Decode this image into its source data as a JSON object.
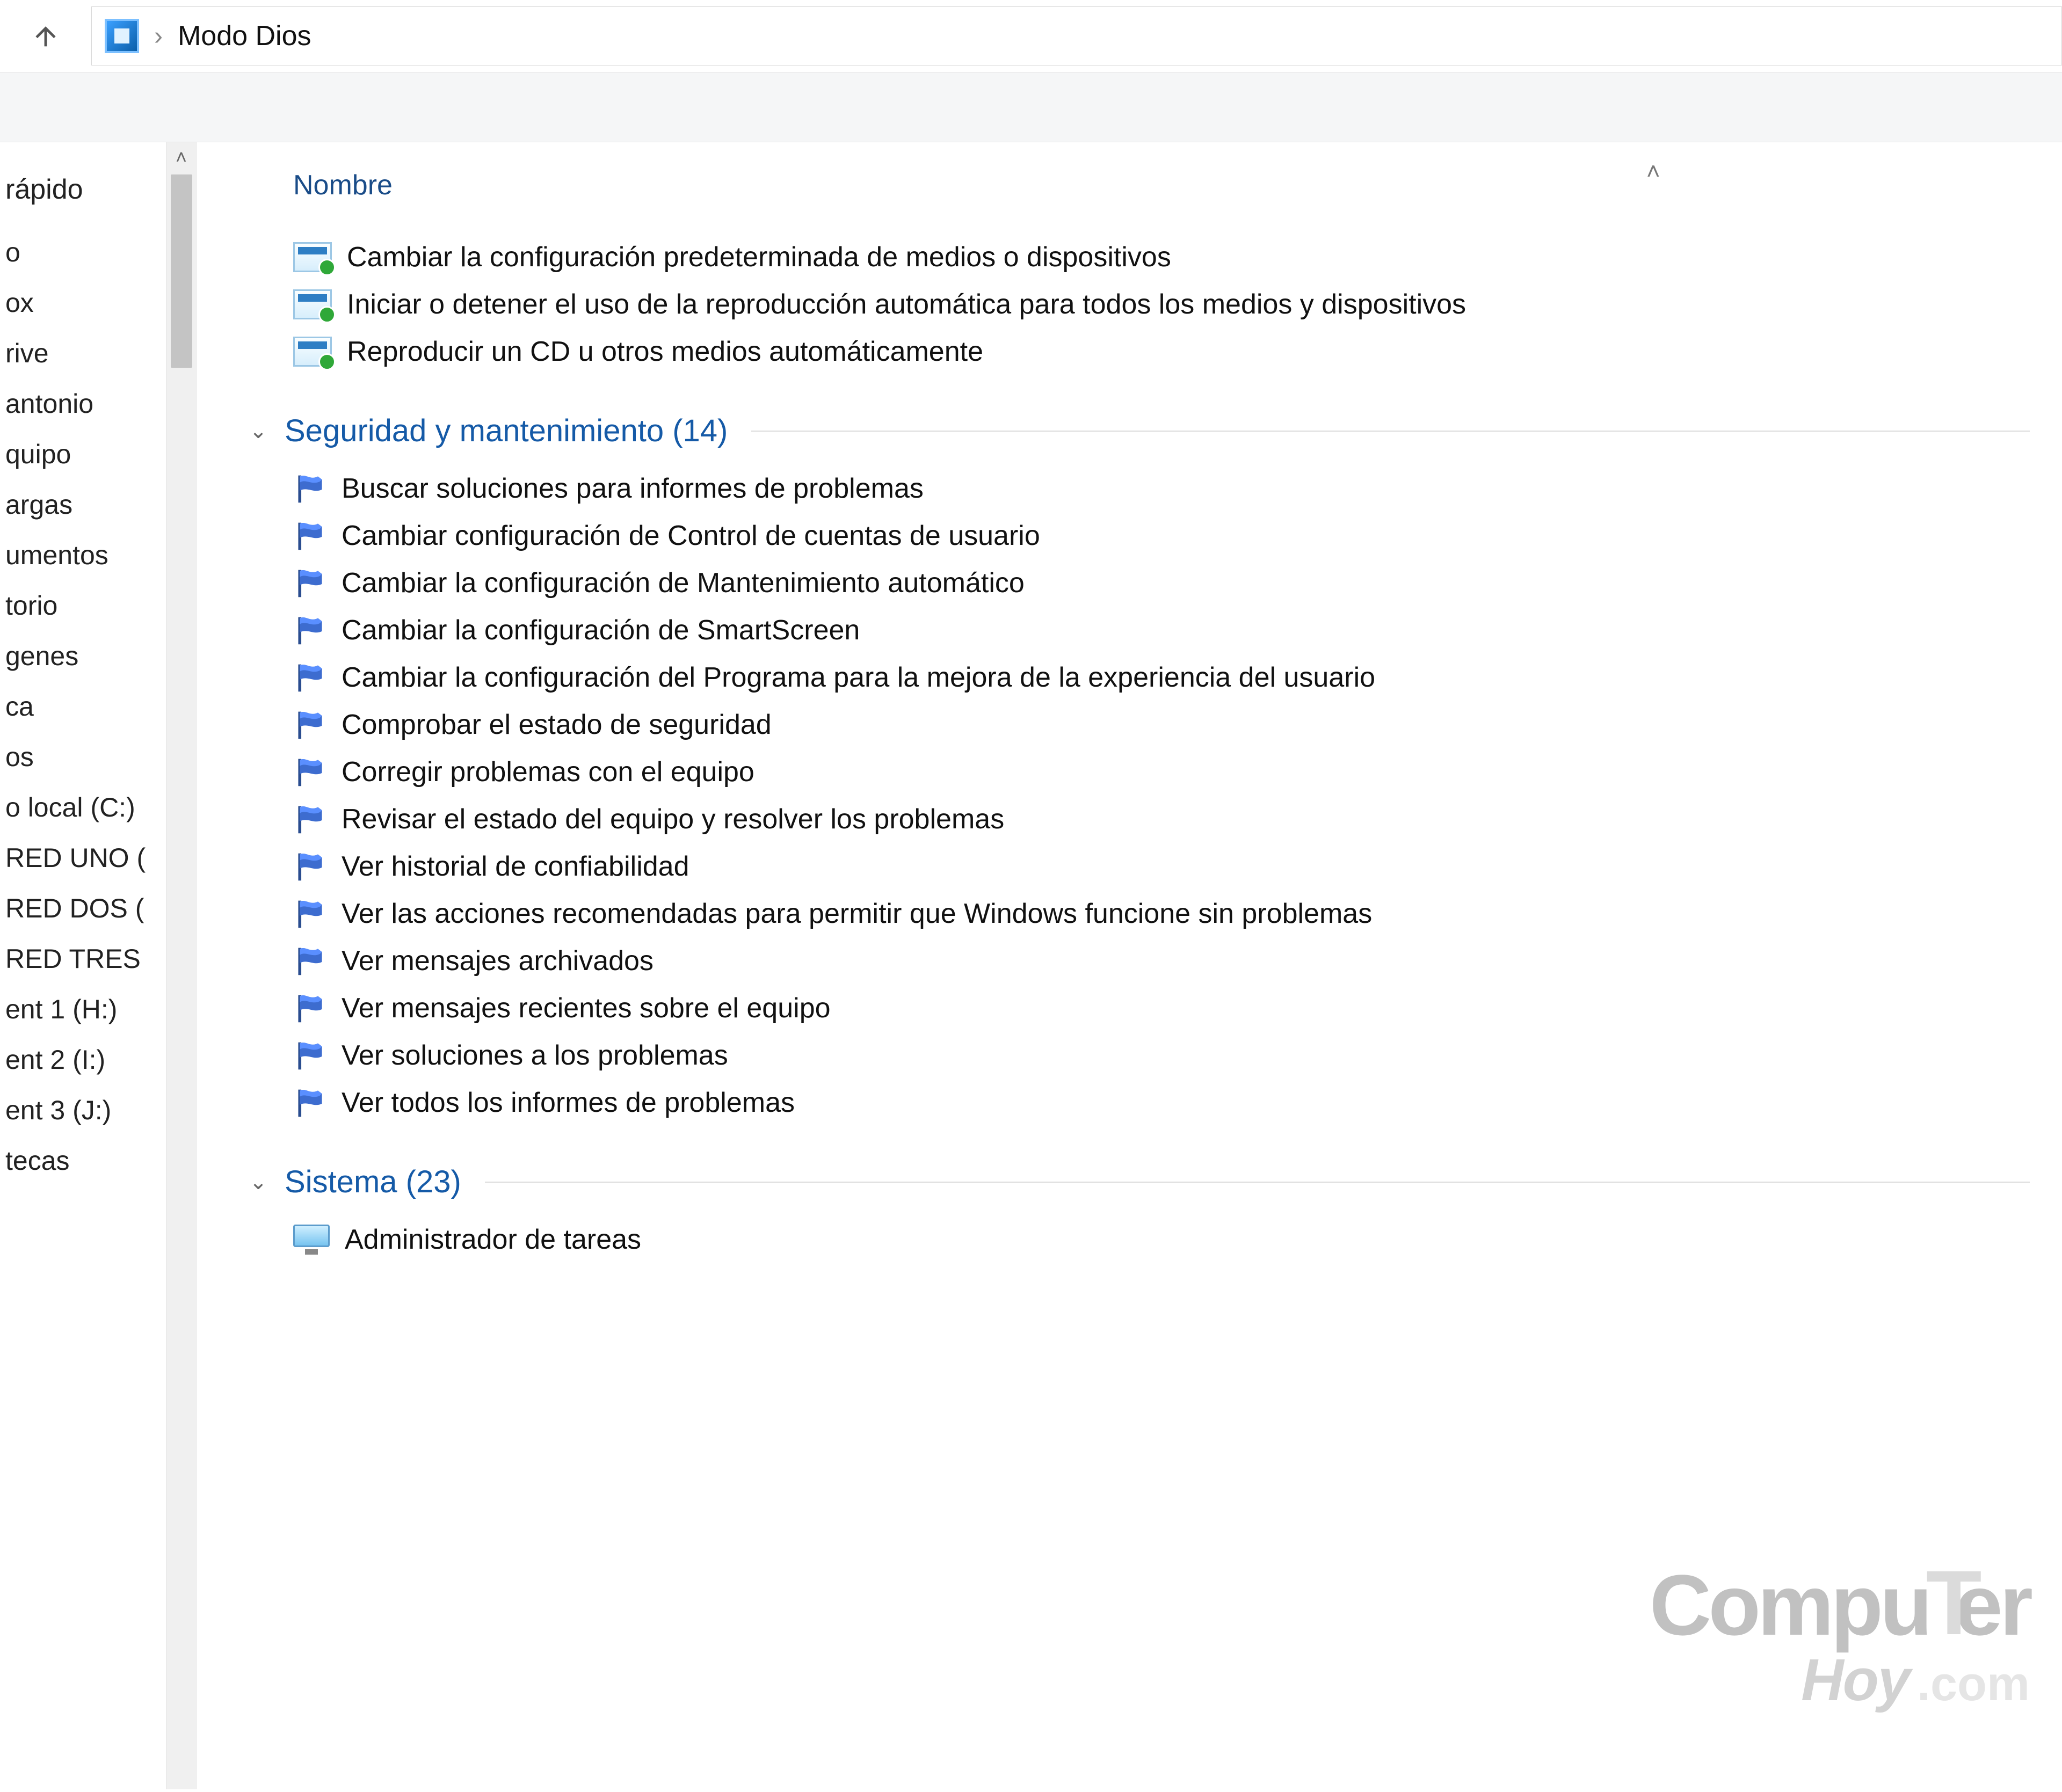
{
  "breadcrumb": {
    "location": "Modo Dios"
  },
  "column_header": "Nombre",
  "sidebar": {
    "header": "rápido",
    "items": [
      "o",
      "ox",
      "rive",
      "antonio",
      "quipo",
      "argas",
      "umentos",
      "torio",
      "genes",
      "ca",
      "os",
      "o local (C:)",
      "RED UNO (",
      "RED DOS (",
      "RED TRES",
      "ent 1 (H:)",
      "ent 2 (I:)",
      "ent 3 (J:)",
      "tecas"
    ]
  },
  "ungrouped": [
    "Cambiar la configuración predeterminada de medios o dispositivos",
    "Iniciar o detener el uso de la reproducción automática para todos los medios y dispositivos",
    "Reproducir un CD u otros medios automáticamente"
  ],
  "groups": [
    {
      "title": "Seguridad y mantenimiento (14)",
      "icon": "flag",
      "items": [
        "Buscar soluciones para informes de problemas",
        "Cambiar configuración de Control de cuentas de usuario",
        "Cambiar la configuración de Mantenimiento automático",
        "Cambiar la configuración de SmartScreen",
        "Cambiar la configuración del Programa para la mejora de la experiencia del usuario",
        "Comprobar el estado de seguridad",
        "Corregir problemas con el equipo",
        "Revisar el estado del equipo y resolver los problemas",
        "Ver historial de confiabilidad",
        "Ver las acciones recomendadas para permitir que Windows funcione sin problemas",
        "Ver mensajes archivados",
        "Ver mensajes recientes sobre el equipo",
        "Ver soluciones a los problemas",
        "Ver todos los informes de problemas"
      ]
    },
    {
      "title": "Sistema (23)",
      "icon": "monitor",
      "items": [
        "Administrador de tareas"
      ]
    }
  ],
  "watermark": {
    "line1a": "Compu",
    "line1b": "er",
    "line2": "Hoy",
    "domain": ".com"
  }
}
